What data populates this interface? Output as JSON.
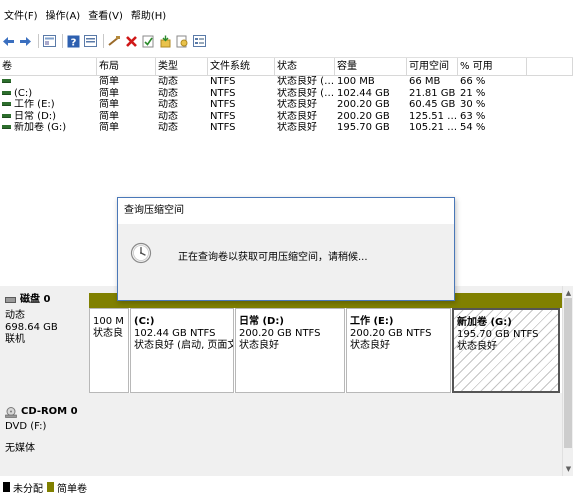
{
  "menu": [
    "文件(F)",
    "操作(A)",
    "查看(V)",
    "帮助(H)"
  ],
  "toolbar_icons": [
    "back-icon",
    "forward-icon",
    "console-icon",
    "help-icon",
    "properties-icon",
    "connect-icon",
    "delete-icon",
    "check-icon",
    "new-icon",
    "search-icon",
    "list-icon"
  ],
  "volume_table": {
    "headers": [
      "卷",
      "布局",
      "类型",
      "文件系统",
      "状态",
      "容量",
      "可用空间",
      "% 可用"
    ],
    "rows": [
      [
        "",
        "简单",
        "动态",
        "NTFS",
        "状态良好 (…",
        "100 MB",
        "66 MB",
        "66 %"
      ],
      [
        "(C:)",
        "简单",
        "动态",
        "NTFS",
        "状态良好 (…",
        "102.44 GB",
        "21.81 GB",
        "21 %"
      ],
      [
        "工作 (E:)",
        "简单",
        "动态",
        "NTFS",
        "状态良好",
        "200.20 GB",
        "60.45 GB",
        "30 %"
      ],
      [
        "日常 (D:)",
        "简单",
        "动态",
        "NTFS",
        "状态良好",
        "200.20 GB",
        "125.51 …",
        "63 %"
      ],
      [
        "新加卷 (G:)",
        "简单",
        "动态",
        "NTFS",
        "状态良好",
        "195.70 GB",
        "105.21 …",
        "54 %"
      ]
    ]
  },
  "dialog": {
    "title": "查询压缩空间",
    "message": "正在查询卷以获取可用压缩空间，请稍候..."
  },
  "disk0": {
    "name": "磁盘 0",
    "type": "动态",
    "size": "698.64 GB",
    "status": "联机",
    "partitions": [
      {
        "name": "",
        "size": "100 M",
        "status": "状态良"
      },
      {
        "name": "(C:)",
        "size": "102.44 GB NTFS",
        "status": "状态良好 (启动, 页面文"
      },
      {
        "name": "日常  (D:)",
        "size": "200.20 GB NTFS",
        "status": "状态良好"
      },
      {
        "name": "工作  (E:)",
        "size": "200.20 GB NTFS",
        "status": "状态良好"
      },
      {
        "name": "新加卷  (G:)",
        "size": "195.70 GB NTFS",
        "status": "状态良好"
      }
    ]
  },
  "cdrom": {
    "name": "CD-ROM 0",
    "drive": "DVD (F:)",
    "media": "无媒体"
  },
  "legend": [
    {
      "label": "未分配",
      "color": "#000000"
    },
    {
      "label": "简单卷",
      "color": "#808000"
    }
  ]
}
